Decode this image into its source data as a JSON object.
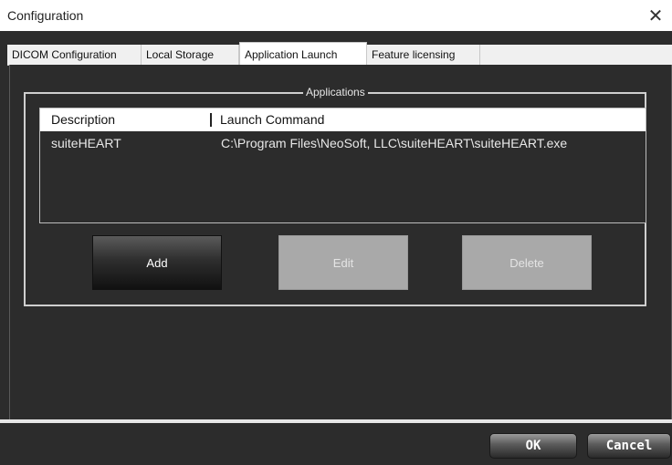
{
  "window": {
    "title": "Configuration",
    "close_glyph": "✕",
    "close_icon": "close-icon"
  },
  "tabs": [
    {
      "label": "DICOM Configuration",
      "active": false
    },
    {
      "label": "Local Storage",
      "active": false
    },
    {
      "label": "Application Launch",
      "active": true
    },
    {
      "label": "Feature licensing",
      "active": false
    }
  ],
  "applications": {
    "group_title": "Applications",
    "columns": [
      "Description",
      "Launch Command"
    ],
    "rows": [
      {
        "description": "suiteHEART",
        "command": "C:\\Program Files\\NeoSoft, LLC\\suiteHEART\\suiteHEART.exe"
      }
    ],
    "buttons": {
      "add": {
        "label": "Add",
        "enabled": true
      },
      "edit": {
        "label": "Edit",
        "enabled": false
      },
      "delete": {
        "label": "Delete",
        "enabled": false
      }
    }
  },
  "footer": {
    "ok_label": "OK",
    "cancel_label": "Cancel"
  },
  "colors": {
    "background": "#2c2c2c",
    "disabled_button": "#a9a9a9",
    "enabled_button": "#2e2e2e"
  }
}
